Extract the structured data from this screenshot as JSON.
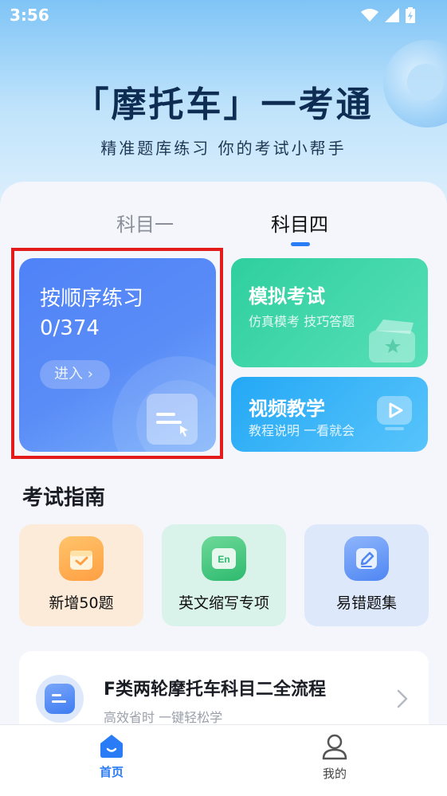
{
  "status_bar": {
    "time": "3:56",
    "icons": [
      "wifi-icon",
      "signal-icon",
      "battery-icon"
    ]
  },
  "header": {
    "title": "「摩托车」一考通",
    "subtitle": "精准题库练习 你的考试小帮手"
  },
  "subject_tabs": [
    {
      "label": "科目一",
      "selected": false
    },
    {
      "label": "科目四",
      "selected": true
    }
  ],
  "practice_card": {
    "title": "按顺序练习",
    "progress": "0/374",
    "enter_label": "进入",
    "icon": "document-icon",
    "highlighted": true
  },
  "mock_exam_card": {
    "title": "模拟考试",
    "subtitle": "仿真模考 技巧答题",
    "icon": "exam-box-icon"
  },
  "video_card": {
    "title": "视频教学",
    "subtitle": "教程说明 一看就会",
    "icon": "play-icon"
  },
  "guide_section": {
    "title": "考试指南",
    "items": [
      {
        "label": "新增50题",
        "icon": "calendar-check-icon"
      },
      {
        "label": "英文缩写专项",
        "icon": "english-abbr-icon"
      },
      {
        "label": "易错题集",
        "icon": "edit-icon"
      }
    ]
  },
  "flow_card": {
    "title": "F类两轮摩托车科目二全流程",
    "subtitle": "高效省时 一键轻松学",
    "icon": "document-list-icon"
  },
  "bottom_nav": [
    {
      "label": "首页",
      "icon": "home-icon",
      "active": true
    },
    {
      "label": "我的",
      "icon": "user-icon",
      "active": false
    }
  ],
  "colors": {
    "accent": "#2a7cf6",
    "practice_card": "#5b8df7",
    "mock_card": "#3fd7a8",
    "video_card": "#3cb6f8",
    "highlight_border": "#e31b1b"
  }
}
